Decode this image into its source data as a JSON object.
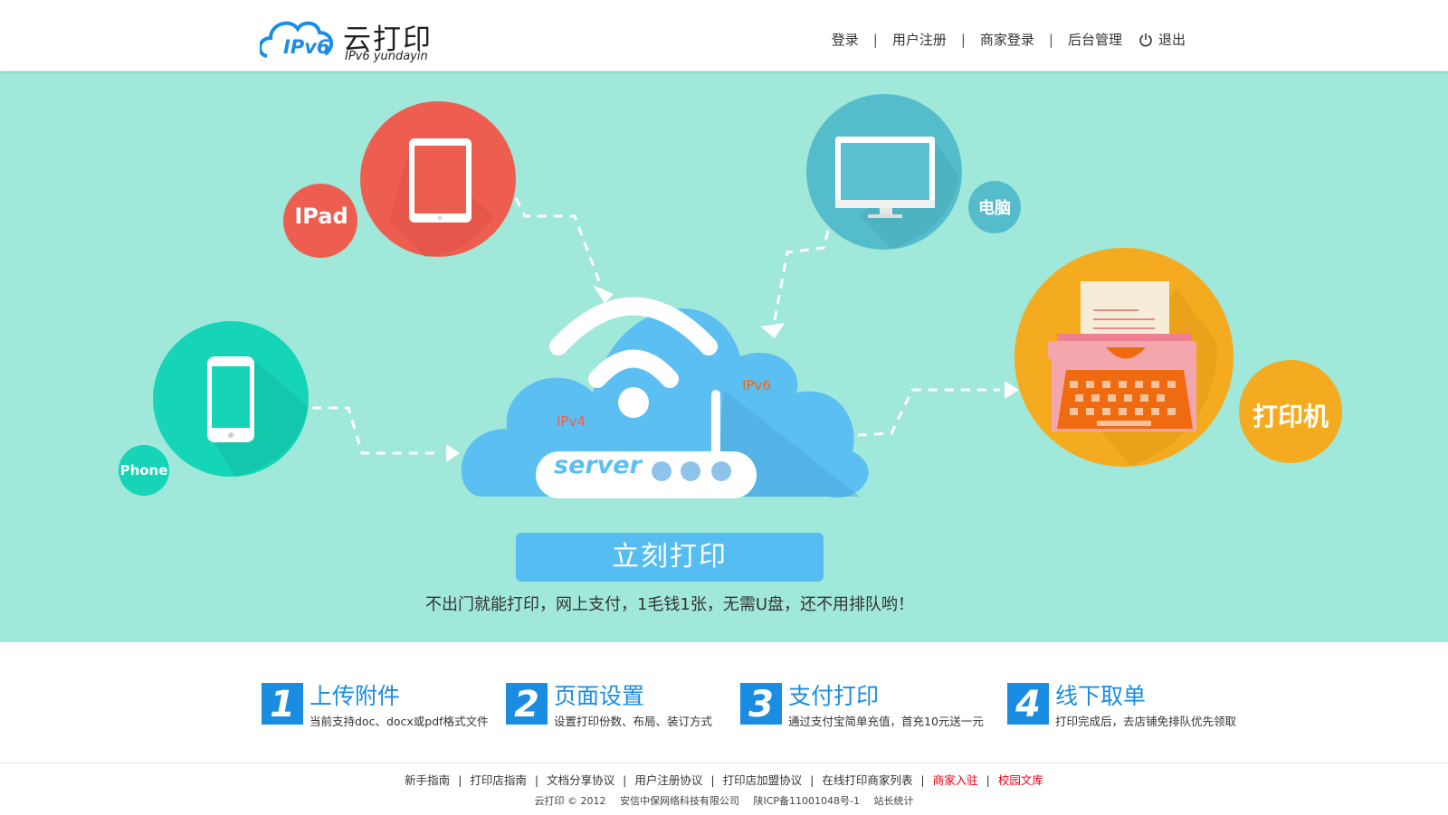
{
  "header": {
    "logo_icon_text": "IPv6",
    "logo_cn": "云打印",
    "logo_en": "IPv6 yundayin",
    "nav": [
      {
        "label": "登录"
      },
      {
        "label": "用户注册"
      },
      {
        "label": "商家登录"
      },
      {
        "label": "后台管理"
      }
    ],
    "nav_separator": "|",
    "logout_label": "退出"
  },
  "hero": {
    "labels": {
      "ipad": "IPad",
      "computer": "电脑",
      "phone": "Phone",
      "printer": "打印机",
      "server": "server",
      "ipv4": "IPv4",
      "ipv6": "IPv6"
    },
    "print_button": "立刻打印",
    "tagline": "不出门就能打印，网上支付，1毛钱1张，无需U盘，还不用排队哟！"
  },
  "steps": [
    {
      "num": "1",
      "title": "上传附件",
      "desc": "当前支持doc、docx或pdf格式文件"
    },
    {
      "num": "2",
      "title": "页面设置",
      "desc": "设置打印份数、布局、装订方式"
    },
    {
      "num": "3",
      "title": "支付打印",
      "desc": "通过支付宝简单充值，首充10元送一元"
    },
    {
      "num": "4",
      "title": "线下取单",
      "desc": "打印完成后，去店铺免排队优先领取"
    }
  ],
  "footer": {
    "links": [
      {
        "label": "新手指南",
        "highlight": false
      },
      {
        "label": "打印店指南",
        "highlight": false
      },
      {
        "label": "文档分享协议",
        "highlight": false
      },
      {
        "label": "用户注册协议",
        "highlight": false
      },
      {
        "label": "打印店加盟协议",
        "highlight": false
      },
      {
        "label": "在线打印商家列表",
        "highlight": false
      },
      {
        "label": "商家入驻",
        "highlight": true
      },
      {
        "label": "校园文库",
        "highlight": true
      }
    ],
    "separator": "|",
    "copyright": "云打印 © 2012",
    "company": "安信中保网络科技有限公司",
    "icp": "陕ICP备11001048号-1",
    "stats": "站长统计"
  },
  "colors": {
    "hero_bg": "#a0e8d9",
    "ipad": "#ee5e50",
    "computer": "#55bccb",
    "phone": "#16d4b8",
    "printer": "#f5ab20",
    "cloud": "#5bbff2",
    "accent_blue": "#1a8de3",
    "highlight_red": "#e60012"
  }
}
